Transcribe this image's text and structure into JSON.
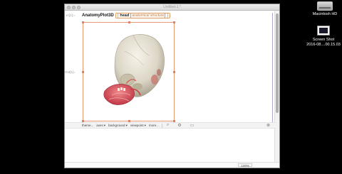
{
  "desktop": {
    "hd_label": "Macintosh HD",
    "screenshot_label": "Screen Shot",
    "screenshot_date": "2016-08....00.15.03"
  },
  "window": {
    "title": "Untitled-1 *",
    "in_label": "In[1]:=",
    "out_label": "Out[1]=",
    "function_name": "AnatomyPlot3D",
    "open_bracket": "[",
    "argument": "head",
    "argument_type": "anatomical structure",
    "close_bracket": "]"
  },
  "toolbar": {
    "theme_label": "theme...",
    "axes_label": "axes",
    "background_label": "background",
    "viewpoint_label": "viewpoint",
    "more_label": "more..."
  },
  "status": {
    "zoom": "100%"
  },
  "icons": [
    "hard-drive-icon",
    "screenshot-file-icon",
    "search-icon",
    "gear-icon",
    "chat-icon",
    "close-icon"
  ]
}
